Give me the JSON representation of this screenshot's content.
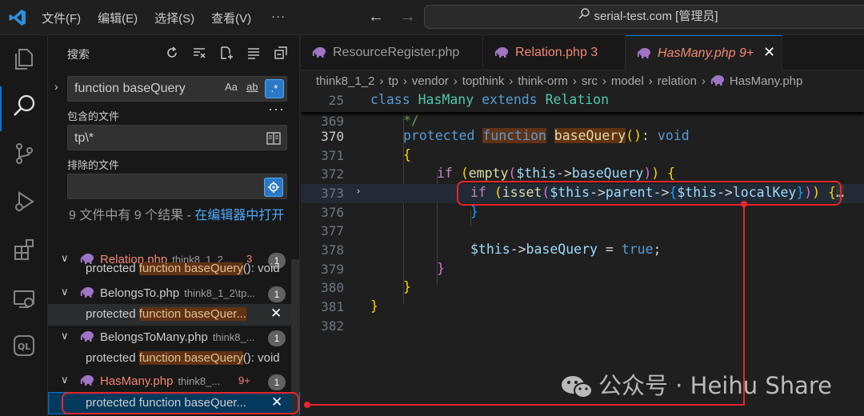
{
  "menu": [
    "文件(F)",
    "编辑(E)",
    "选择(S)",
    "查看(V)",
    "···"
  ],
  "command_center": "serial-test.com [管理员]",
  "sidebar": {
    "title": "搜索",
    "search_value": "function baseQuery",
    "opt_case": "Aa",
    "opt_word": "ab",
    "opt_regex": ".*",
    "include_label": "包含的文件",
    "include_value": "tp\\*",
    "exclude_label": "排除的文件",
    "exclude_value": "",
    "summary": "9 文件中有 9 个结果 - ",
    "summary_link": "在编辑器中打开",
    "results": [
      {
        "file": "Relation.php",
        "path": "think8_1_2...",
        "errors": "3",
        "count": "1",
        "match_pre": "protected ",
        "match_hl": "function baseQuery",
        "match_post": "(): void"
      },
      {
        "file": "BelongsTo.php",
        "path": "think8_1_2\\tp...",
        "errors": "",
        "count": "1",
        "match_pre": "protected ",
        "match_hl": "function baseQuer...",
        "match_post": ""
      },
      {
        "file": "BelongsToMany.php",
        "path": "think8_...",
        "errors": "",
        "count": "1",
        "match_pre": "protected ",
        "match_hl": "function baseQuery",
        "match_post": "(): void"
      },
      {
        "file": "HasMany.php",
        "path": "think8_...",
        "errors": "9+",
        "count": "1",
        "match_pre": "protected ",
        "match_hl": "function baseQuer...",
        "match_post": ""
      }
    ]
  },
  "tabs": [
    {
      "label": "ResourceRegister.php",
      "badge": ""
    },
    {
      "label": "Relation.php",
      "badge": "3"
    },
    {
      "label": "HasMany.php",
      "badge": "9+"
    }
  ],
  "breadcrumb": [
    "think8_1_2",
    "tp",
    "vendor",
    "topthink",
    "think-orm",
    "src",
    "model",
    "relation",
    "HasMany.php"
  ],
  "editor": {
    "sticky": {
      "ln": "25",
      "kw1": "class",
      "name": "HasMany",
      "kw2": "extends",
      "parent": "Relation"
    },
    "lines": [
      {
        "ln": "369",
        "text": "*/"
      },
      {
        "ln": "370",
        "text": "protected function baseQuery(): void"
      },
      {
        "ln": "371",
        "text": "{"
      },
      {
        "ln": "372",
        "text": "if (empty($this->baseQuery)) {"
      },
      {
        "ln": "373",
        "text": "if (isset($this->parent->{$this->localKey})) {…"
      },
      {
        "ln": "376",
        "text": "}"
      },
      {
        "ln": "377",
        "text": ""
      },
      {
        "ln": "378",
        "text": "$this->baseQuery = true;"
      },
      {
        "ln": "379",
        "text": "}"
      },
      {
        "ln": "380",
        "text": "}"
      },
      {
        "ln": "381",
        "text": "}"
      },
      {
        "ln": "382",
        "text": ""
      }
    ]
  },
  "watermark": "公众号 · Heihu Share",
  "colors": {
    "accent": "#0078d4",
    "annotation": "#e8262c",
    "error": "#f48771",
    "modified": "#e2c08d"
  }
}
